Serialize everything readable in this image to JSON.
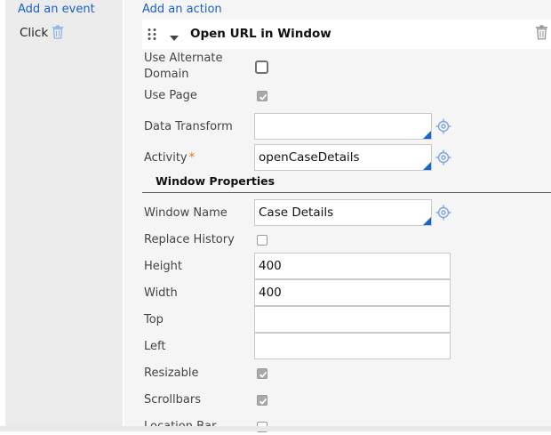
{
  "events": {
    "add_link": "Add an event",
    "items": [
      {
        "label": "Click"
      }
    ]
  },
  "actions": {
    "add_link": "Add an action",
    "current": {
      "title": "Open URL in Window",
      "fields": {
        "use_alternate_domain": {
          "label": "Use Alternate Domain",
          "label_line1": "Use Alternate",
          "label_line2": "Domain",
          "checked": false
        },
        "use_page": {
          "label": "Use Page",
          "checked": true
        },
        "data_transform": {
          "label": "Data Transform",
          "value": ""
        },
        "activity": {
          "label": "Activity",
          "required_mark": "*",
          "value": "openCaseDetails"
        }
      },
      "window_properties": {
        "title": "Window Properties",
        "window_name": {
          "label": "Window Name",
          "value": "Case Details"
        },
        "replace_history": {
          "label": "Replace History",
          "checked": false
        },
        "height": {
          "label": "Height",
          "value": "400"
        },
        "width": {
          "label": "Width",
          "value": "400"
        },
        "top": {
          "label": "Top",
          "value": ""
        },
        "left": {
          "label": "Left",
          "value": ""
        },
        "resizable": {
          "label": "Resizable",
          "checked": true
        },
        "scrollbars": {
          "label": "Scrollbars",
          "checked": true
        },
        "location_bar": {
          "label": "Location Bar",
          "checked": false
        }
      }
    }
  },
  "icons": {
    "delete": "trash-icon",
    "drag": "drag-handle-icon",
    "collapse": "caret-down-icon",
    "property_picker": "crosshair-gear-icon"
  },
  "colors": {
    "link": "#1a5fc6",
    "required": "#e07a00",
    "autocomplete_corner": "#1466d0",
    "picker_icon": "#7aa7e0"
  }
}
